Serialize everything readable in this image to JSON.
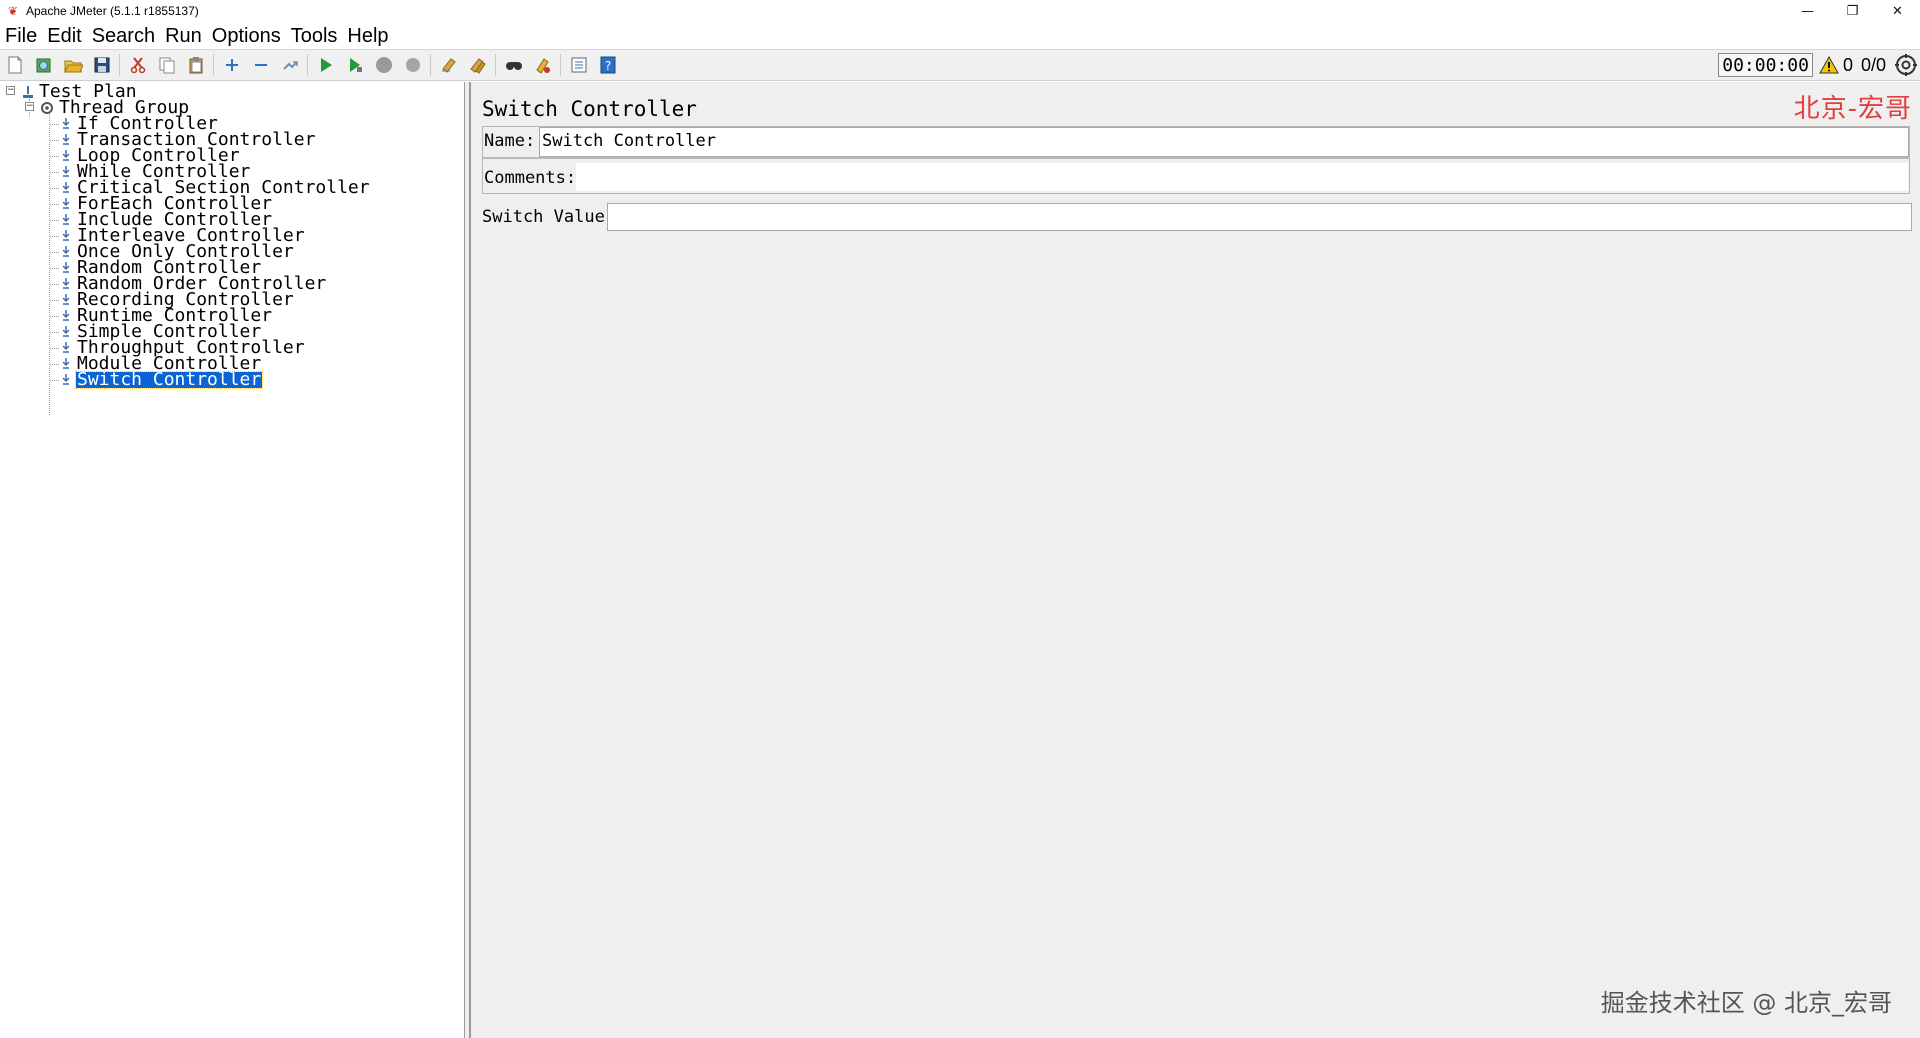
{
  "window": {
    "title": "Apache JMeter (5.1.1 r1855137)",
    "minimize": "—",
    "restore": "❐",
    "close": "✕"
  },
  "menu": [
    "File",
    "Edit",
    "Search",
    "Run",
    "Options",
    "Tools",
    "Help"
  ],
  "toolbar": {
    "timer": "00:00:00",
    "warnings": "0",
    "threads": "0/0",
    "icons": [
      "new-icon",
      "templates-icon",
      "open-icon",
      "save-icon",
      "cut-icon",
      "copy-icon",
      "paste-icon",
      "expand-icon",
      "collapse-icon",
      "toggle-icon",
      "start-icon",
      "start-no-pause-icon",
      "stop-icon",
      "shutdown-icon",
      "clear-icon",
      "clear-all-icon",
      "search-icon",
      "reset-search-icon",
      "function-helper-icon",
      "help-icon"
    ]
  },
  "tree": {
    "root": "Test Plan",
    "group": "Thread Group",
    "items": [
      "If Controller",
      "Transaction Controller",
      "Loop Controller",
      "While Controller",
      "Critical Section Controller",
      "ForEach Controller",
      "Include Controller",
      "Interleave Controller",
      "Once Only Controller",
      "Random Controller",
      "Random Order Controller",
      "Recording Controller",
      "Runtime Controller",
      "Simple Controller",
      "Throughput Controller",
      "Module Controller",
      "Switch Controller"
    ],
    "selected": "Switch Controller"
  },
  "panel": {
    "title": "Switch Controller",
    "name_label": "Name:",
    "name_value": "Switch Controller",
    "comments_label": "Comments:",
    "comments_value": "",
    "switch_label": "Switch Value",
    "switch_value": ""
  },
  "watermarks": {
    "top": "北京-宏哥",
    "bottom": "掘金技术社区 @ 北京_宏哥"
  }
}
